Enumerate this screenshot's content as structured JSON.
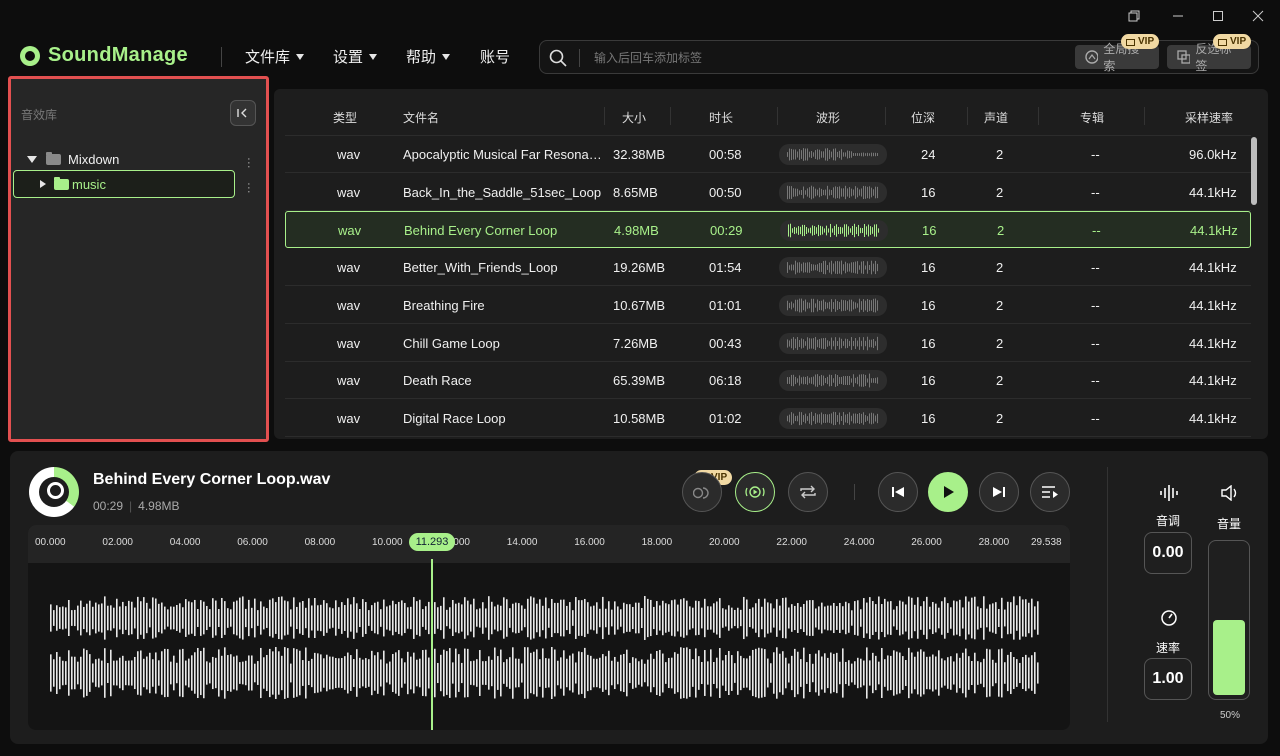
{
  "app": {
    "name": "SoundManage",
    "nav": [
      {
        "label": "文件库",
        "dropdown": true
      },
      {
        "label": "设置",
        "dropdown": true
      },
      {
        "label": "帮助",
        "dropdown": true
      },
      {
        "label": "账号",
        "dropdown": false
      }
    ]
  },
  "search": {
    "placeholder": "输入后回车添加标签",
    "global_search_label": "全局搜索",
    "invert_tags_label": "反选标签",
    "vip_badge": "VIP"
  },
  "library": {
    "title": "音效库",
    "tree": [
      {
        "label": "Mixdown",
        "expanded": true,
        "selected": false
      },
      {
        "label": "music",
        "expanded": false,
        "selected": true
      }
    ]
  },
  "table": {
    "headers": [
      "类型",
      "文件名",
      "大小",
      "时长",
      "波形",
      "位深",
      "声道",
      "专辑",
      "采样速率"
    ],
    "rows": [
      {
        "type": "wav",
        "name": "Apocalyptic Musical Far Resonant...",
        "size": "32.38MB",
        "duration": "00:58",
        "depth": "24",
        "channels": "2",
        "album": "--",
        "rate": "96.0kHz",
        "selected": false
      },
      {
        "type": "wav",
        "name": "Back_In_the_Saddle_51sec_Loop",
        "size": "8.65MB",
        "duration": "00:50",
        "depth": "16",
        "channels": "2",
        "album": "--",
        "rate": "44.1kHz",
        "selected": false
      },
      {
        "type": "wav",
        "name": "Behind Every Corner Loop",
        "size": "4.98MB",
        "duration": "00:29",
        "depth": "16",
        "channels": "2",
        "album": "--",
        "rate": "44.1kHz",
        "selected": true
      },
      {
        "type": "wav",
        "name": "Better_With_Friends_Loop",
        "size": "19.26MB",
        "duration": "01:54",
        "depth": "16",
        "channels": "2",
        "album": "--",
        "rate": "44.1kHz",
        "selected": false
      },
      {
        "type": "wav",
        "name": "Breathing Fire",
        "size": "10.67MB",
        "duration": "01:01",
        "depth": "16",
        "channels": "2",
        "album": "--",
        "rate": "44.1kHz",
        "selected": false
      },
      {
        "type": "wav",
        "name": "Chill Game Loop",
        "size": "7.26MB",
        "duration": "00:43",
        "depth": "16",
        "channels": "2",
        "album": "--",
        "rate": "44.1kHz",
        "selected": false
      },
      {
        "type": "wav",
        "name": "Death Race",
        "size": "65.39MB",
        "duration": "06:18",
        "depth": "16",
        "channels": "2",
        "album": "--",
        "rate": "44.1kHz",
        "selected": false
      },
      {
        "type": "wav",
        "name": "Digital Race Loop",
        "size": "10.58MB",
        "duration": "01:02",
        "depth": "16",
        "channels": "2",
        "album": "--",
        "rate": "44.1kHz",
        "selected": false
      }
    ]
  },
  "player": {
    "title": "Behind Every Corner Loop.wav",
    "duration": "00:29",
    "size": "4.98MB",
    "vip_badge": "VIP",
    "timeline_ticks": [
      "00.000",
      "02.000",
      "04.000",
      "06.000",
      "08.000",
      "10.000",
      "12.000",
      "14.000",
      "16.000",
      "18.000",
      "20.000",
      "22.000",
      "24.000",
      "26.000",
      "28.000",
      "29.538"
    ],
    "playhead_time": "11.293",
    "progress_fraction": 0.382,
    "pitch_label": "音调",
    "pitch_value": "0.00",
    "rate_label": "速率",
    "rate_value": "1.00",
    "volume_label": "音量",
    "volume_value": "50%",
    "volume_fraction": 0.5
  },
  "colors": {
    "accent": "#a8f08a",
    "highlight_border": "#e25050",
    "vip": "#f1d9a3"
  }
}
